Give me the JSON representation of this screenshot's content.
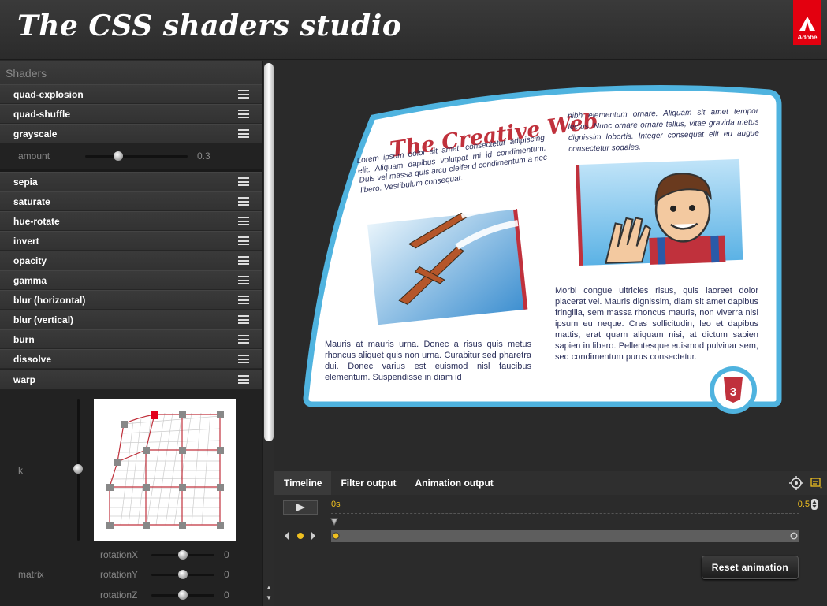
{
  "app": {
    "title": "The CSS shaders studio",
    "brand": "Adobe"
  },
  "sidebar": {
    "heading": "Shaders",
    "shaders": [
      {
        "label": "quad-explosion"
      },
      {
        "label": "quad-shuffle"
      },
      {
        "label": "grayscale",
        "params": [
          {
            "label": "amount",
            "value": "0.3",
            "fraction": 0.3
          }
        ]
      },
      {
        "label": "sepia"
      },
      {
        "label": "saturate"
      },
      {
        "label": "hue-rotate"
      },
      {
        "label": "invert"
      },
      {
        "label": "opacity"
      },
      {
        "label": "gamma"
      },
      {
        "label": "blur (horizontal)"
      },
      {
        "label": "blur (vertical)"
      },
      {
        "label": "burn"
      },
      {
        "label": "dissolve"
      },
      {
        "label": "warp"
      }
    ],
    "warp": {
      "k_label": "k",
      "matrix_label": "matrix",
      "rotations": [
        {
          "label": "rotationX",
          "value": "0"
        },
        {
          "label": "rotationY",
          "value": "0"
        },
        {
          "label": "rotationZ",
          "value": "0"
        }
      ]
    }
  },
  "preview": {
    "headline": "The Creative Web",
    "col1_top": "Lorem ipsum dolor sit amet, consectetur adipiscing elit. Aliquam dapibus volutpat mi id condimentum. Duis vel massa quis arcu eleifend condimentum a nec libero. Vestibulum consequat.",
    "col1_bottom": "Mauris at mauris urna. Donec a risus quis metus rhoncus aliquet quis non urna. Curabitur sed pharetra dui. Donec varius est euismod nisl faucibus elementum. Suspendisse in diam id",
    "col2_top": "nibh elementum ornare. Aliquam sit amet tempor lectus. Nunc ornare ornare tellus, vitae gravida metus dignissim lobortis. Integer consequat elit eu augue consectetur sodales.",
    "col2_bottom": "Morbi congue ultricies risus, quis laoreet dolor placerat vel. Mauris dignissim, diam sit amet dapibus fringilla, sem massa rhoncus mauris, non viverra nisl ipsum eu neque. Cras sollicitudin, leo et dapibus mattis, erat quam aliquam nisi, at dictum sapien sapien in libero. Pellentesque euismod pulvinar sem, sed condimentum purus consectetur.",
    "badge_text": "3"
  },
  "bottom": {
    "tabs": [
      {
        "label": "Timeline"
      },
      {
        "label": "Filter output"
      },
      {
        "label": "Animation output"
      }
    ],
    "time_start": "0s",
    "time_end": "0.5",
    "reset_label": "Reset animation"
  },
  "colors": {
    "accent": "#e3000f",
    "frame": "#4fb3df",
    "headline": "#c0313c",
    "timeline": "#f0c020"
  }
}
